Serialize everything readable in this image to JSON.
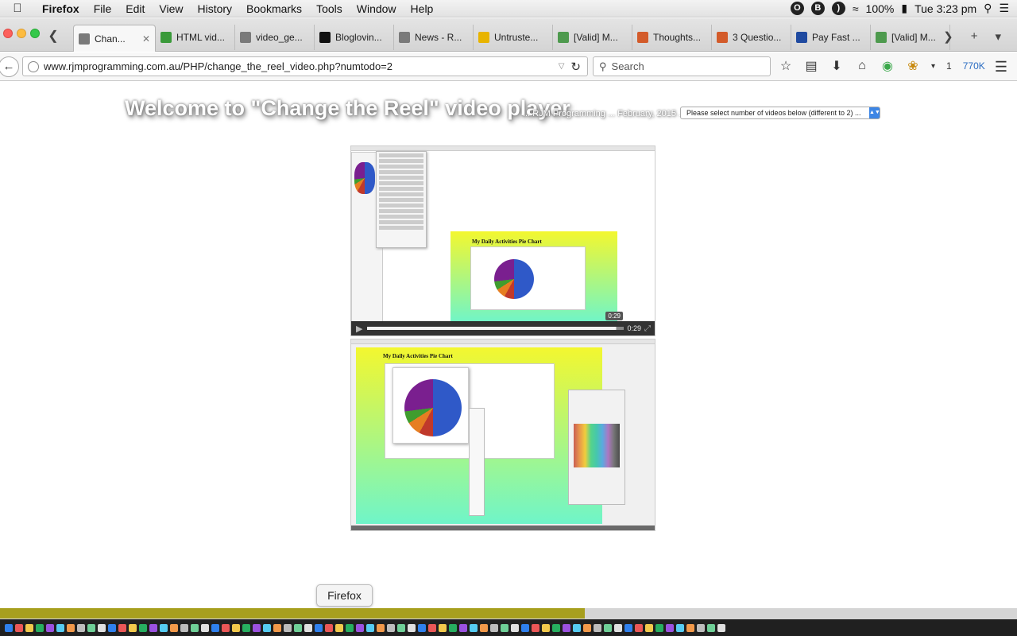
{
  "menubar": {
    "app": "Firefox",
    "items": [
      "File",
      "Edit",
      "View",
      "History",
      "Bookmarks",
      "Tools",
      "Window",
      "Help"
    ],
    "battery": "100%",
    "clock": "Tue 3:23 pm"
  },
  "tabs": [
    {
      "label": "Chan...",
      "favicon_color": "#7a7a7a",
      "active": true
    },
    {
      "label": "HTML vid...",
      "favicon_color": "#3a9a3a"
    },
    {
      "label": "video_ge...",
      "favicon_color": "#7a7a7a"
    },
    {
      "label": "Bloglovin...",
      "favicon_color": "#111111"
    },
    {
      "label": "News - R...",
      "favicon_color": "#7a7a7a"
    },
    {
      "label": "Untruste...",
      "favicon_color": "#e8b400"
    },
    {
      "label": "[Valid] M...",
      "favicon_color": "#4e9a4e"
    },
    {
      "label": "Thoughts...",
      "favicon_color": "#d35b2a"
    },
    {
      "label": "3 Questio...",
      "favicon_color": "#d35b2a"
    },
    {
      "label": "Pay Fast ...",
      "favicon_color": "#1f4aa0"
    },
    {
      "label": "[Valid] M...",
      "favicon_color": "#4e9a4e"
    }
  ],
  "navbar": {
    "url": "www.rjmprogramming.com.au/PHP/change_the_reel_video.php?numtodo=2",
    "search_placeholder": "Search",
    "count": "1",
    "size": "770K"
  },
  "page": {
    "heading": "Welcome to \"Change the Reel\" video player",
    "heading_sub": "... RJM Programming ... February, 2015 ...",
    "select_value": "Please select number of videos below (different to 2) ..."
  },
  "video1": {
    "title": "My Daily Activities Pie Chart",
    "time": "0:29",
    "tooltip": "0:29",
    "progress": 0.97
  },
  "video2": {
    "title": "My Daily Activities Pie Chart"
  },
  "dock": {
    "tooltip": "Firefox"
  }
}
